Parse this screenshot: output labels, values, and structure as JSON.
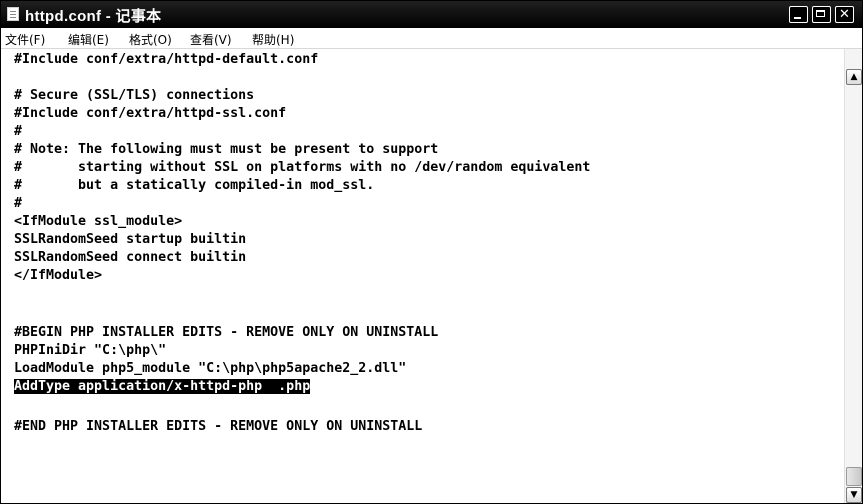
{
  "window": {
    "title": "httpd.conf - 记事本",
    "controls": {
      "minimize_icon": "minimize-icon",
      "maximize_icon": "maximize-icon",
      "close_glyph": "✕"
    }
  },
  "menu": {
    "items": [
      {
        "label": "文件(F)"
      },
      {
        "label": "编辑(E)"
      },
      {
        "label": "格式(O)"
      },
      {
        "label": "查看(V)"
      },
      {
        "label": "帮助(H)"
      }
    ]
  },
  "editor": {
    "lines": [
      "#Include conf/extra/httpd-default.conf",
      "",
      "# Secure (SSL/TLS) connections",
      "#Include conf/extra/httpd-ssl.conf",
      "#",
      "# Note: The following must must be present to support",
      "#       starting without SSL on platforms with no /dev/random equivalent",
      "#       but a statically compiled-in mod_ssl.",
      "#",
      "<IfModule ssl_module>",
      "SSLRandomSeed startup builtin",
      "SSLRandomSeed connect builtin",
      "</IfModule>",
      "",
      "",
      "#BEGIN PHP INSTALLER EDITS - REMOVE ONLY ON UNINSTALL",
      "PHPIniDir \"C:\\php\\\"",
      "LoadModule php5_module \"C:\\php\\php5apache2_2.dll\"",
      "AddType application/x-httpd-php  .php",
      "",
      "#END PHP INSTALLER EDITS - REMOVE ONLY ON UNINSTALL"
    ],
    "selected_line": "AddType application/x-httpd-php  .php"
  },
  "scrollbar": {
    "up_glyph": "▲",
    "down_glyph": "▼"
  }
}
